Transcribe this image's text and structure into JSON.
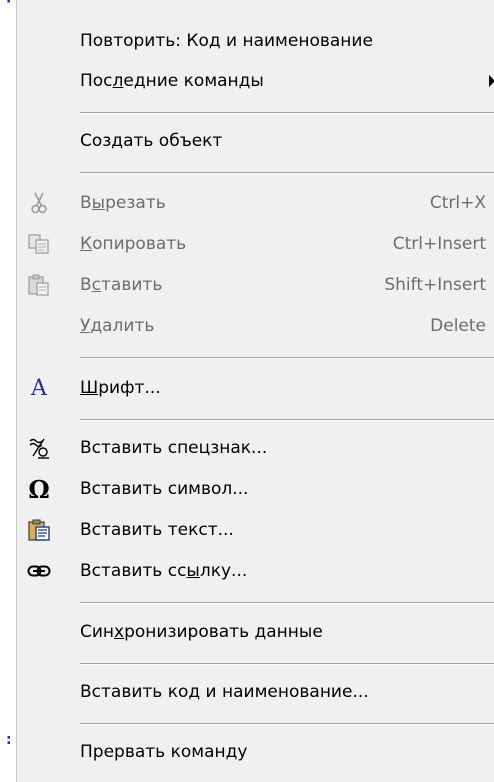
{
  "menu": {
    "items": [
      {
        "label": "Повторить: Код и наименование"
      },
      {
        "label_pre": "Пос",
        "label_u": "л",
        "label_post": "едние команды"
      },
      {
        "label": "Создать объект"
      },
      {
        "label_pre": "В",
        "label_u": "ы",
        "label_post": "резать",
        "shortcut": "Ctrl+X",
        "icon": "scissors-icon"
      },
      {
        "label_pre": "",
        "label_u": "К",
        "label_post": "опировать",
        "shortcut": "Ctrl+Insert",
        "icon": "copy-icon"
      },
      {
        "label_pre": "В",
        "label_u": "с",
        "label_post": "тавить",
        "shortcut": "Shift+Insert",
        "icon": "paste-icon"
      },
      {
        "label_pre": "",
        "label_u": "У",
        "label_post": "далить",
        "shortcut": "Delete"
      },
      {
        "label_pre": "",
        "label_u": "Ш",
        "label_post": "рифт...",
        "icon": "font-icon",
        "icon_glyph": "A"
      },
      {
        "label": "Вставить спецзнак...",
        "icon": "special-sign-icon",
        "icon_glyph": "≈/o"
      },
      {
        "label": "Вставить символ...",
        "icon": "omega-icon",
        "icon_glyph": "Ω"
      },
      {
        "label": "Вставить текст...",
        "icon": "insert-text-icon"
      },
      {
        "label_pre": "Вставить сс",
        "label_u": "ы",
        "label_post": "лку...",
        "icon": "link-icon"
      },
      {
        "label_pre": "Син",
        "label_u": "х",
        "label_post": "ронизировать данные"
      },
      {
        "label": "Вставить код и наименование..."
      },
      {
        "label": "Прервать команду"
      }
    ]
  },
  "colors": {
    "menu_bg": "#f0f0f0",
    "disabled_text": "#6d6d6d",
    "font_icon": "#2828a0",
    "accent_blue": "#1f2fc8"
  }
}
